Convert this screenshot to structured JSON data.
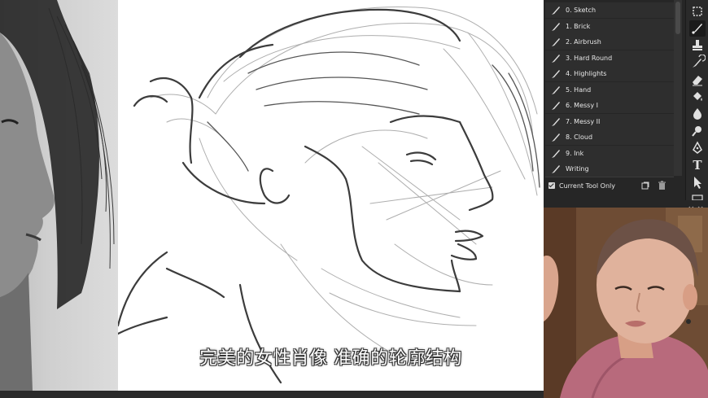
{
  "brush_presets": {
    "items": [
      {
        "label": "0. Sketch"
      },
      {
        "label": "1. Brick"
      },
      {
        "label": "2. Airbrush"
      },
      {
        "label": "3. Hard Round"
      },
      {
        "label": "4. Highlights"
      },
      {
        "label": "5. Hand"
      },
      {
        "label": "6. Messy I"
      },
      {
        "label": "7. Messy II"
      },
      {
        "label": "8. Cloud"
      },
      {
        "label": "9. Ink"
      },
      {
        "label": "Writing"
      }
    ],
    "current_tool_only": {
      "label": "Current Tool Only",
      "checked": true
    }
  },
  "toolbar": {
    "items": [
      "artboard-icon",
      "brush-icon",
      "stamp-icon",
      "history-brush-icon",
      "eraser-icon",
      "paint-bucket-icon",
      "blur-icon",
      "dodge-icon",
      "pen-icon",
      "type-icon",
      "path-select-icon"
    ],
    "active": "brush-icon",
    "type_glyph": "T"
  },
  "subtitle": {
    "text": "完美的女性肖像 准确的轮廓结构"
  },
  "colors": {
    "panel_bg": "#262626",
    "row_bg": "#2e2e2e",
    "canvas_bg": "#ffffff",
    "stroke": "#3c3c3c"
  }
}
